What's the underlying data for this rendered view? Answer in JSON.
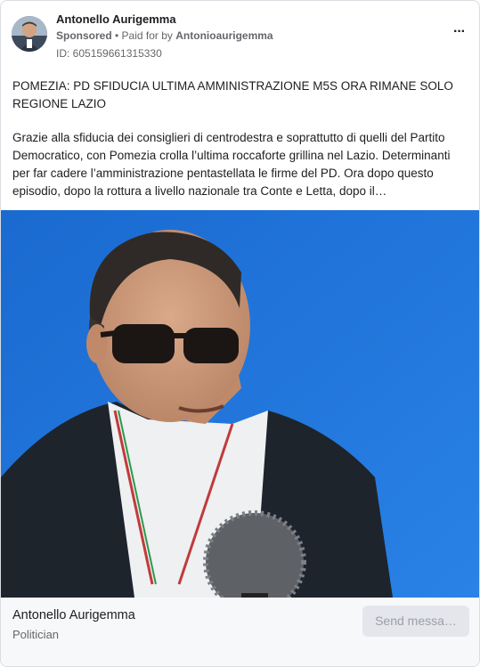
{
  "header": {
    "page_name": "Antonello Aurigemma",
    "sponsored": "Sponsored",
    "separator": " • ",
    "paid_for_prefix": "Paid for by ",
    "paid_for_by": "Antonioaurigemma",
    "ad_id": "ID: 605159661315330",
    "more_icon": "more-horizontal-icon",
    "more_label": "···"
  },
  "body": {
    "headline": "POMEZIA: PD SFIDUCIA ULTIMA AMMINISTRAZIONE M5S ORA RIMANE SOLO REGIONE LAZIO",
    "paragraph": "Grazie alla sfiducia dei consiglieri di centrodestra e soprattutto di quelli del Partito Democratico, con Pomezia crolla l’ultima roccaforte grillina nel Lazio. Determinanti per far cadere l’amministrazione pentastellata le firme del PD. Ora dopo questo episodio, dopo la rottura a livello nazionale tra Conte e Letta, dopo il…"
  },
  "media": {
    "background_color": "#1f74d6"
  },
  "footer": {
    "name": "Antonello Aurigemma",
    "category": "Politician",
    "cta_label": "Send messa…"
  }
}
